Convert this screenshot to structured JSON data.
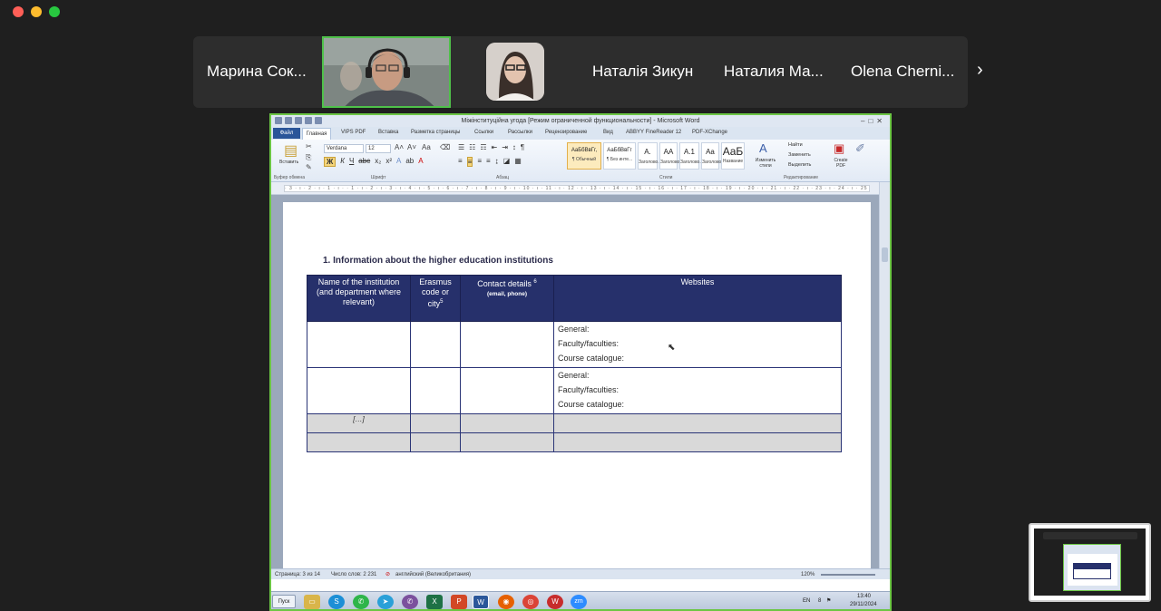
{
  "participants": {
    "items": [
      {
        "name": "Марина Сок..."
      },
      {
        "name": "Наталія Зикун"
      },
      {
        "name": "Наталия Ма..."
      },
      {
        "name": "Olena Cherni..."
      }
    ],
    "next_label": "›"
  },
  "word": {
    "window_title": "Міжінституційна угода [Режим ограниченной функциональности] - Microsoft Word",
    "tabs": [
      "Файл",
      "Главная",
      "VIPS PDF",
      "Вставка",
      "Разметка страницы",
      "Ссылки",
      "Рассылки",
      "Рецензирование",
      "Вид",
      "ABBYY FineReader 12",
      "PDF-XChange"
    ],
    "ribbon": {
      "paste_label": "Вставить",
      "clipboard_label": "Буфер обмена",
      "font_name": "Verdana",
      "font_size": "12",
      "font_group": "Шрифт",
      "paragraph_group": "Абзац",
      "styles_group": "Стили",
      "styles": [
        {
          "preview": "АаБбВвГг,",
          "name": "¶ Обычный"
        },
        {
          "preview": "АаБбВвГг",
          "name": "¶ Без инте..."
        },
        {
          "preview": "A.",
          "name": "Заголово..."
        },
        {
          "preview": "AA",
          "name": "Заголово..."
        },
        {
          "preview": "A.1",
          "name": "Заголово..."
        },
        {
          "preview": "Aa",
          "name": "Заголово..."
        },
        {
          "preview": "AaБ",
          "name": "Название"
        }
      ],
      "change_styles": "Изменить стили",
      "find": "Найти",
      "replace": "Заменить",
      "select": "Выделить",
      "edit_group": "Редактирование",
      "create_pdf": "Create PDF"
    },
    "ruler_text": "· 3 · ı · 2 · ı · 1 · ı · · 1 · ı · 2 · ı · 3 · ı · 4 · ı · 5 · ı · 6 · ı · 7 · ı · 8 · ı · 9 · ı · 10 · ı · 11 · ı · 12 · ı · 13 · ı · 14 · ı · 15 · ı · 16 · ı · 17 · ı · 18 · ı · 19 · ı · 20 · ı · 21 · ı · 22 · ı · 23 · ı · 24 · ı · 25 ·",
    "document": {
      "heading": "1.  Information about the higher education institutions",
      "columns": {
        "c1": "Name of the institution  (and department where relevant)",
        "c2": "Erasmus code or city",
        "c2_sup": "5",
        "c3": "Contact details",
        "c3_sup": "6",
        "c3_sub": "(email, phone)",
        "c4": "Websites"
      },
      "rows": [
        {
          "websites": [
            "General:",
            "Faculty/faculties:",
            "Course catalogue:"
          ]
        },
        {
          "websites": [
            "General:",
            "Faculty/faculties:",
            "Course catalogue:"
          ]
        }
      ],
      "ellipsis": "[…]"
    },
    "status": {
      "page": "Страница: 3 из 14",
      "words": "Число слов: 2 231",
      "language": "английский (Великобритания)",
      "zoom": "120%"
    }
  },
  "taskbar": {
    "start": "Пуск",
    "lang": "EN",
    "time": "13:40",
    "date": "29/11/2024"
  },
  "colors": {
    "header_navy": "#26306b",
    "active_border": "#6cc644",
    "ribbon_bg": "#e2eaf5"
  }
}
